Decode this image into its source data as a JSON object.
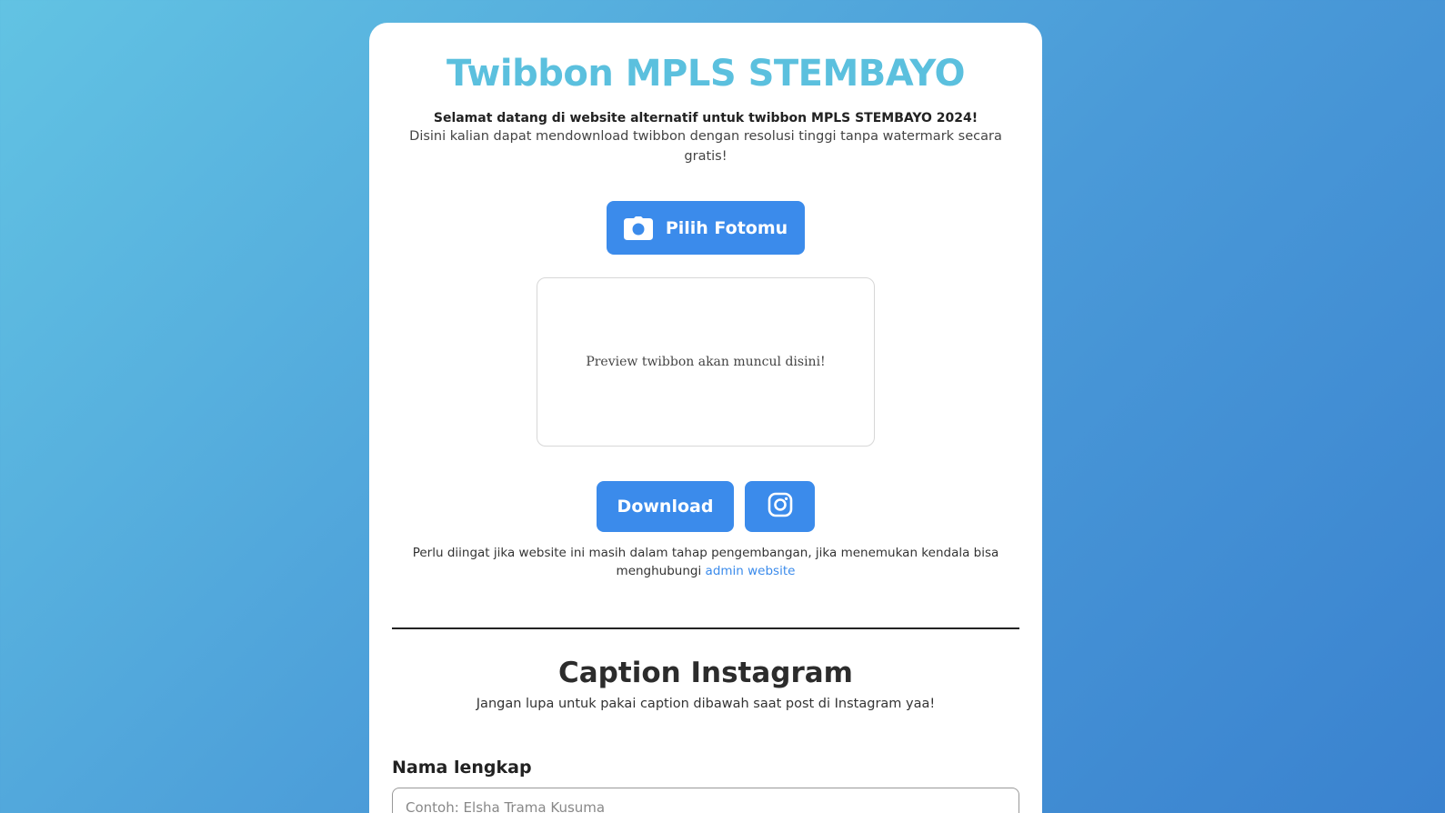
{
  "header": {
    "title": "Twibbon MPLS STEMBAYO",
    "welcome": "Selamat datang di website alternatif untuk twibbon MPLS STEMBAYO 2024!",
    "description": "Disini kalian dapat mendownload twibbon dengan resolusi tinggi tanpa watermark secara gratis!"
  },
  "actions": {
    "choose_photo_label": "Pilih Fotomu",
    "choose_photo_icon": "camera-icon",
    "download_label": "Download",
    "instagram_icon": "instagram-icon"
  },
  "preview": {
    "placeholder_text": "Preview twibbon akan muncul disini!"
  },
  "note": {
    "text": "Perlu diingat jika website ini masih dalam tahap pengembangan, jika menemukan kendala bisa menghubungi",
    "link_text": "admin website"
  },
  "caption": {
    "title": "Caption Instagram",
    "subtitle": "Jangan lupa untuk pakai caption dibawah saat post di Instagram yaa!"
  },
  "form": {
    "full_name_label": "Nama lengkap",
    "full_name_placeholder": "Contoh: Elsha Trama Kusuma"
  },
  "colors": {
    "title": "#5bc0de",
    "button": "#3b8beb",
    "link": "#3b8beb"
  }
}
